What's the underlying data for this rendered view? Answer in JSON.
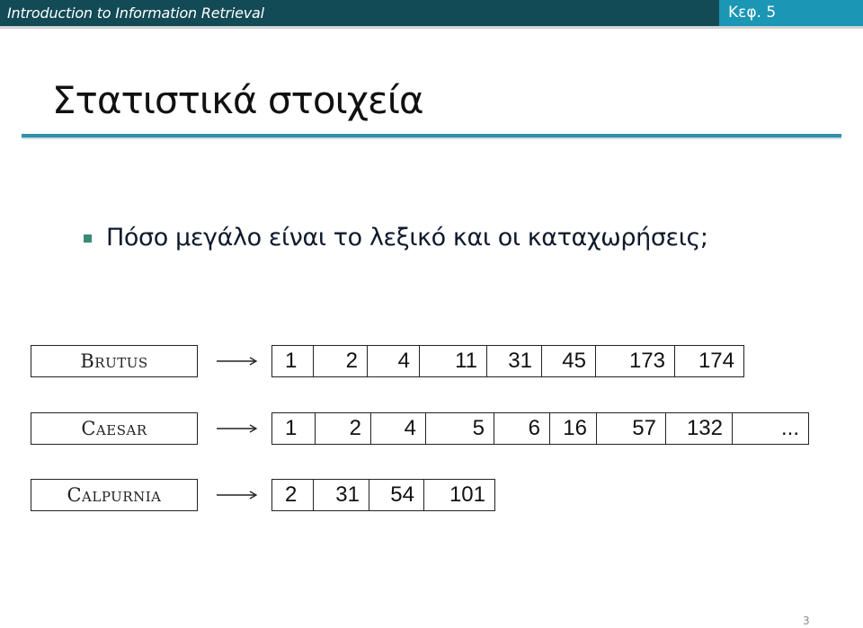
{
  "header": {
    "course_title": "Introduction to Information Retrieval",
    "chapter": "Κεφ. 5",
    "colors": {
      "bar": "#124a55",
      "chapter_box": "#1b96b4",
      "title_rule": "#2a92ad",
      "bullet": "#3a8b76"
    }
  },
  "slide": {
    "title": "Στατιστικά στοιχεία",
    "bullets": [
      {
        "icon": "square-bullet-icon",
        "text": "Πόσο μεγάλο είναι το λεξικό και οι καταχωρήσεις;"
      }
    ],
    "page_number": "3"
  },
  "inverted_index": {
    "arrow_icon": "long-right-arrow-icon",
    "terms": [
      {
        "term": "Brutus",
        "postings": [
          "1",
          "2",
          "4",
          "11",
          "31",
          "45",
          "173",
          "174"
        ]
      },
      {
        "term": "Caesar",
        "postings": [
          "1",
          "2",
          "4",
          "5",
          "6",
          "16",
          "57",
          "132",
          "..."
        ]
      },
      {
        "term": "Calpurnia",
        "postings": [
          "2",
          "31",
          "54",
          "101"
        ]
      }
    ]
  }
}
